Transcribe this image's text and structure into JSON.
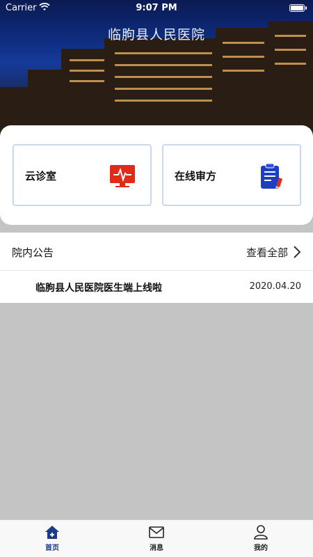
{
  "status_bar": {
    "carrier": "Carrier",
    "time": "9:07 PM"
  },
  "hero": {
    "title": "临朐县人民医院"
  },
  "quick_actions": [
    {
      "label": "云诊室",
      "icon": "monitor-heartbeat-icon",
      "color": "#e02a1a"
    },
    {
      "label": "在线审方",
      "icon": "clipboard-pen-icon",
      "color": "#1d3fbf"
    }
  ],
  "announcements": {
    "title": "院内公告",
    "view_all": "查看全部",
    "items": [
      {
        "text": "临朐县人民医院医生端上线啦",
        "date": "2020.04.20"
      }
    ]
  },
  "tabbar": {
    "active_color": "#1a3a8a",
    "tabs": [
      {
        "label": "首页",
        "icon": "home-icon"
      },
      {
        "label": "消息",
        "icon": "mail-icon"
      },
      {
        "label": "我的",
        "icon": "user-icon"
      }
    ]
  }
}
